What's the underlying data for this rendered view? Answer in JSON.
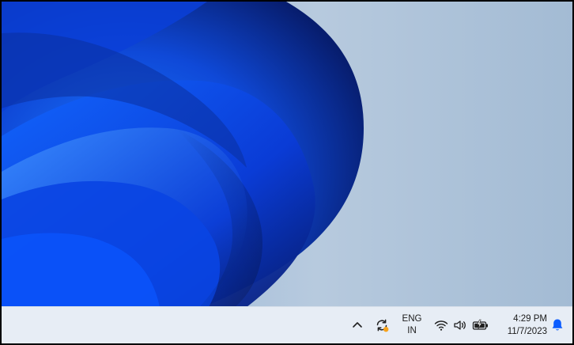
{
  "taskbar": {
    "language": {
      "line1": "ENG",
      "line2": "IN"
    },
    "clock": {
      "time": "4:29 PM",
      "date": "11/7/2023"
    }
  },
  "icons": {
    "overflow": "chevron-up-icon",
    "sync": "sync-icon",
    "wifi": "wifi-icon",
    "volume": "volume-icon",
    "battery": "battery-charging-icon",
    "notifications": "bell-icon"
  },
  "colors": {
    "taskbar_bg": "#e7edf5",
    "accent": "#0b5cff",
    "alert_dot": "#f7a21b"
  }
}
